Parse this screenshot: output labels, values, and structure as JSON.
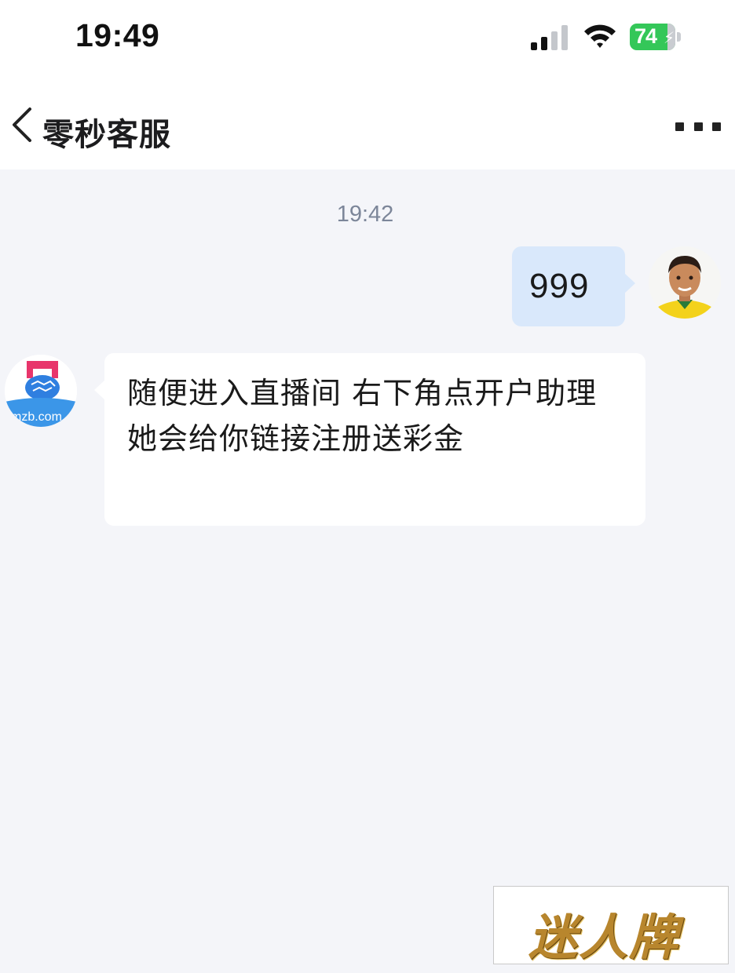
{
  "status_bar": {
    "time": "19:49",
    "battery_level": "74",
    "battery_charging": true,
    "signal_icon": "cellular-signal-icon",
    "wifi_icon": "wifi-icon"
  },
  "nav": {
    "title": "零秒客服",
    "back_icon": "chevron-left-icon",
    "more_icon": "more-icon"
  },
  "chat": {
    "timestamp": "19:42",
    "messages": [
      {
        "from": "user",
        "text": "999"
      },
      {
        "from": "service",
        "text": "随便进入直播间  右下角点开户助理 她会给你链接注册送彩金"
      }
    ],
    "service_avatar_text": "mzb.com"
  },
  "watermark": {
    "text": "迷人牌"
  },
  "colors": {
    "background": "#f4f5f9",
    "outgoing_bubble": "#d9e8fb",
    "incoming_bubble": "#ffffff",
    "battery": "#34c759",
    "timestamp": "#7c8699"
  }
}
